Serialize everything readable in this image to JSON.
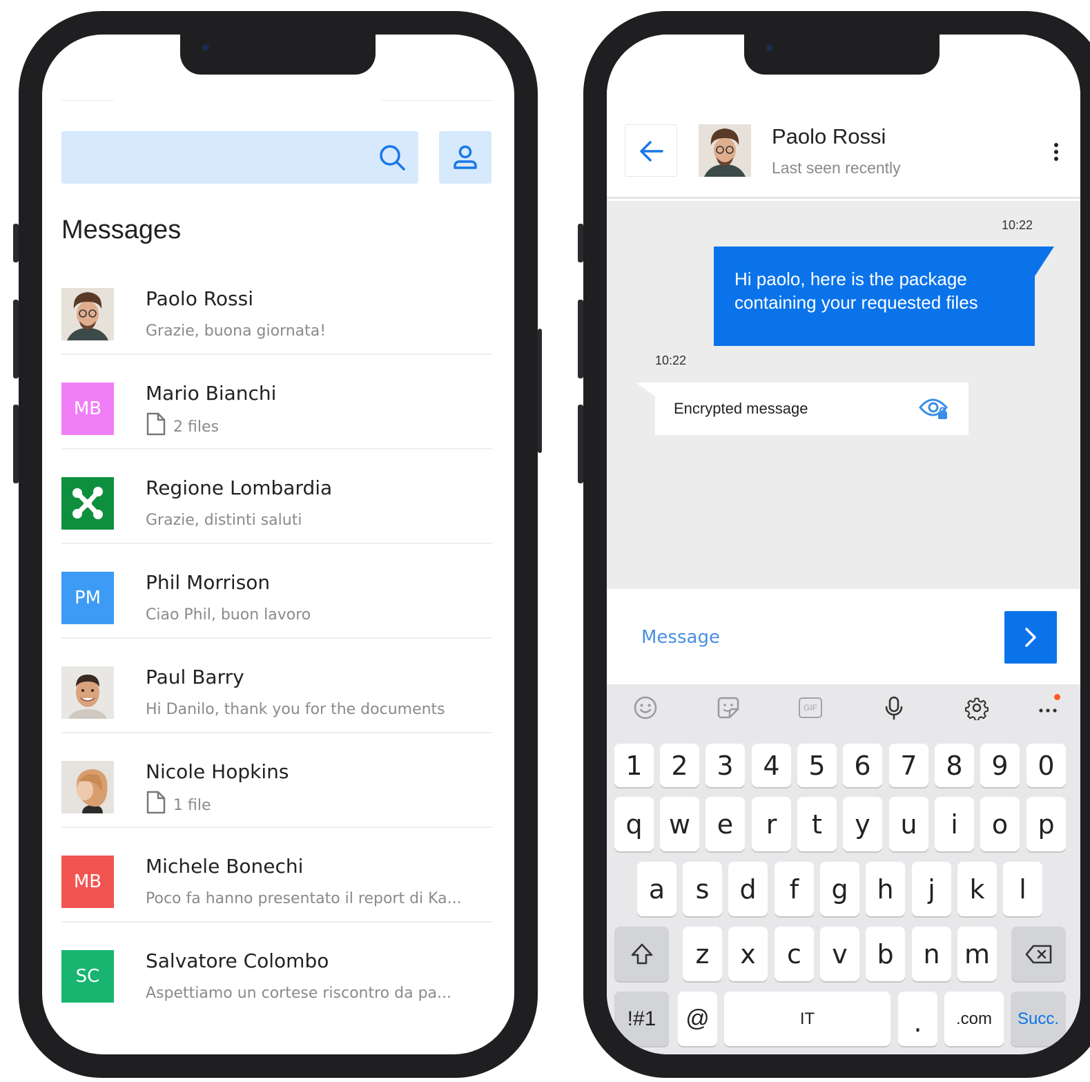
{
  "messages_screen": {
    "title": "Messages",
    "search": {
      "placeholder": ""
    },
    "conversations": [
      {
        "name": "Paolo Rossi",
        "preview": "Grazie, buona giornata!",
        "avatar": "photo-man-curly"
      },
      {
        "name": "Mario Bianchi",
        "preview": "2 files",
        "avatar_initials": "MB",
        "avatar_color": "#f17ef6",
        "has_file_icon": true
      },
      {
        "name": "Regione Lombardia",
        "preview": "Grazie, distinti saluti",
        "avatar": "regione-lombardia-logo",
        "avatar_color": "#0e8f3e"
      },
      {
        "name": "Phil Morrison",
        "preview": "Ciao Phil, buon lavoro",
        "avatar_initials": "PM",
        "avatar_color": "#3d9bf5"
      },
      {
        "name": "Paul Barry",
        "preview": "Hi Danilo, thank you for the documents",
        "avatar": "photo-man-smiling"
      },
      {
        "name": "Nicole Hopkins",
        "preview": "1 file",
        "avatar": "photo-woman-blonde",
        "has_file_icon": true
      },
      {
        "name": "Michele Bonechi",
        "preview": "Poco fa hanno presentato il report di Ka...",
        "avatar_initials": "MB",
        "avatar_color": "#f25451"
      },
      {
        "name": "Salvatore Colombo",
        "preview": "Aspettiamo un cortese riscontro da pa...",
        "avatar_initials": "SC",
        "avatar_color": "#17b56f"
      }
    ]
  },
  "chat_screen": {
    "contact": {
      "name": "Paolo Rossi",
      "status": "Last seen recently"
    },
    "messages": [
      {
        "direction": "outgoing",
        "time": "10:22",
        "text": "Hi paolo, here is the package containing your requested files"
      },
      {
        "direction": "incoming",
        "time": "10:22",
        "text": "Encrypted message"
      }
    ],
    "composer": {
      "placeholder": "Message"
    },
    "keyboard": {
      "tools": [
        "emoji-icon",
        "sticker-icon",
        "gif-icon",
        "microphone-icon",
        "settings-gear-icon",
        "more-dots-icon"
      ],
      "gif_label": "GIF",
      "row_numbers": [
        "1",
        "2",
        "3",
        "4",
        "5",
        "6",
        "7",
        "8",
        "9",
        "0"
      ],
      "row_1": [
        "q",
        "w",
        "e",
        "r",
        "t",
        "y",
        "u",
        "i",
        "o",
        "p"
      ],
      "row_2": [
        "a",
        "s",
        "d",
        "f",
        "g",
        "h",
        "j",
        "k",
        "l"
      ],
      "row_3": [
        "z",
        "x",
        "c",
        "v",
        "b",
        "n",
        "m"
      ],
      "bottom": {
        "symbols": "!#1",
        "at": "@",
        "space": "IT",
        "period": ".",
        "dotcom": ".com",
        "enter": "Succ."
      }
    }
  },
  "colors": {
    "accent": "#0b73ea",
    "search_bg": "#d6e9fd",
    "chat_bg": "#ececed",
    "keyboard_bg": "#e8e8ea"
  }
}
